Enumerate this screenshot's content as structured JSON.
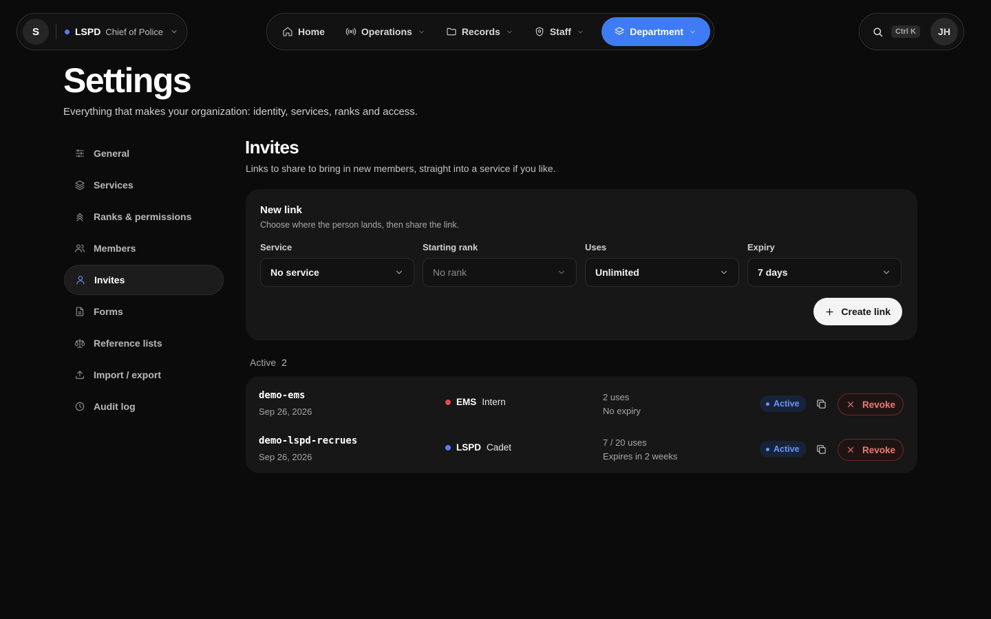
{
  "org": {
    "avatar": "S",
    "name": "LSPD",
    "role": "Chief of Police",
    "dot_color": "#5b7bff"
  },
  "nav": {
    "items": [
      {
        "label": "Home",
        "icon": "home-icon"
      },
      {
        "label": "Operations",
        "icon": "broadcast-icon"
      },
      {
        "label": "Records",
        "icon": "folder-icon"
      },
      {
        "label": "Staff",
        "icon": "shield-icon"
      },
      {
        "label": "Department",
        "icon": "layers-icon",
        "active": true
      }
    ],
    "accent": "#3f7bf2"
  },
  "utility": {
    "shortcut": "Ctrl K",
    "user_initials": "JH"
  },
  "header": {
    "title": "Settings",
    "subtitle": "Everything that makes your organization: identity, services, ranks and access."
  },
  "sidebar": {
    "items": [
      {
        "label": "General",
        "icon": "sliders-icon"
      },
      {
        "label": "Services",
        "icon": "layers-icon"
      },
      {
        "label": "Ranks & permissions",
        "icon": "chevrons-up-icon"
      },
      {
        "label": "Members",
        "icon": "users-icon"
      },
      {
        "label": "Invites",
        "icon": "user-icon",
        "active": true
      },
      {
        "label": "Forms",
        "icon": "file-icon"
      },
      {
        "label": "Reference lists",
        "icon": "scale-icon"
      },
      {
        "label": "Import / export",
        "icon": "upload-icon"
      },
      {
        "label": "Audit log",
        "icon": "clock-icon"
      }
    ]
  },
  "invites": {
    "title": "Invites",
    "subtitle": "Links to share to bring in new members, straight into a service if you like.",
    "new_link": {
      "title": "New link",
      "subtitle": "Choose where the person lands, then share the link.",
      "fields": [
        {
          "label": "Service",
          "value": "No service"
        },
        {
          "label": "Starting rank",
          "value": "No rank",
          "disabled": true
        },
        {
          "label": "Uses",
          "value": "Unlimited"
        },
        {
          "label": "Expiry",
          "value": "7 days"
        }
      ],
      "create_label": "Create link"
    },
    "active": {
      "label": "Active",
      "count": "2",
      "rows": [
        {
          "code": "demo-ems",
          "date": "Sep 26, 2026",
          "service": "EMS",
          "service_color": "#e5484d",
          "rank": "Intern",
          "uses": "2 uses",
          "expiry": "No expiry",
          "status": "Active",
          "revoke_label": "Revoke"
        },
        {
          "code": "demo-lspd-recrues",
          "date": "Sep 26, 2026",
          "service": "LSPD",
          "service_color": "#5b7bff",
          "rank": "Cadet",
          "uses": "7 / 20 uses",
          "expiry": "Expires in 2 weeks",
          "status": "Active",
          "revoke_label": "Revoke"
        }
      ]
    }
  }
}
